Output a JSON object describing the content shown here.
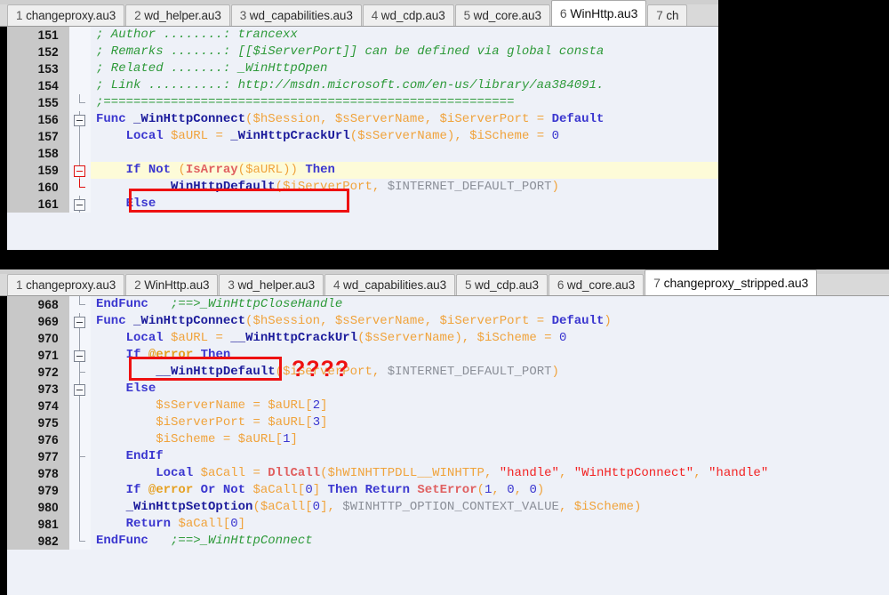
{
  "meta": {
    "app": "AutoIt Script Editor",
    "accent_annotation_color": "#ee1111",
    "highlight_line_color": "#fdfbd8",
    "code_background": "#eef1f8",
    "gutter_background": "#c8c8c8"
  },
  "top_panel": {
    "name": "original-winhttp-source",
    "active_tab_index": 5,
    "tabs": [
      {
        "num": "1",
        "label": "changeproxy.au3"
      },
      {
        "num": "2",
        "label": "wd_helper.au3"
      },
      {
        "num": "3",
        "label": "wd_capabilities.au3"
      },
      {
        "num": "4",
        "label": "wd_cdp.au3"
      },
      {
        "num": "5",
        "label": "wd_core.au3"
      },
      {
        "num": "6",
        "label": "WinHttp.au3"
      },
      {
        "num": "7",
        "label": "ch"
      }
    ],
    "first_line_number": 151,
    "highlighted_line": 159,
    "annotation": {
      "boxed_text": "If Not (IsArray($aURL))",
      "boxed_line": 159
    },
    "lines": [
      {
        "n": "151",
        "fold": "none",
        "text": "; Author ........: trancexx"
      },
      {
        "n": "152",
        "fold": "none",
        "text": "; Remarks .......: [[$iServerPort]] can be defined via global consta"
      },
      {
        "n": "153",
        "fold": "none",
        "text": "; Related .......: _WinHttpOpen"
      },
      {
        "n": "154",
        "fold": "none",
        "text": "; Link ..........: http://msdn.microsoft.com/en-us/library/aa384091."
      },
      {
        "n": "155",
        "fold": "end",
        "text": ";======================================================="
      },
      {
        "n": "156",
        "fold": "box",
        "text": "Func _WinHttpConnect($hSession, $sServerName, $iServerPort = Default"
      },
      {
        "n": "157",
        "fold": "line",
        "text": "    Local $aURL = _WinHttpCrackUrl($sServerName), $iScheme = 0"
      },
      {
        "n": "158",
        "fold": "line",
        "text": ""
      },
      {
        "n": "159",
        "fold": "box-red",
        "text": "    If Not (IsArray($aURL)) Then"
      },
      {
        "n": "160",
        "fold": "end-red",
        "text": "        __WinHttpDefault($iServerPort, $INTERNET_DEFAULT_PORT)"
      },
      {
        "n": "161",
        "fold": "box",
        "text": "    Else"
      }
    ]
  },
  "bottom_panel": {
    "name": "stripped-changeproxy-source",
    "active_tab_index": 6,
    "tabs": [
      {
        "num": "1",
        "label": "changeproxy.au3"
      },
      {
        "num": "2",
        "label": "WinHttp.au3"
      },
      {
        "num": "3",
        "label": "wd_helper.au3"
      },
      {
        "num": "4",
        "label": "wd_capabilities.au3"
      },
      {
        "num": "5",
        "label": "wd_cdp.au3"
      },
      {
        "num": "6",
        "label": "wd_core.au3"
      },
      {
        "num": "7",
        "label": "changeproxy_stripped.au3"
      }
    ],
    "first_line_number": 968,
    "annotation": {
      "boxed_text": "If @error Then",
      "boxed_line": 971,
      "marker_text": "????"
    },
    "lines": [
      {
        "n": "968",
        "fold": "end",
        "text": "EndFunc   ;==>_WinHttpCloseHandle"
      },
      {
        "n": "969",
        "fold": "box",
        "text": "Func _WinHttpConnect($hSession, $sServerName, $iServerPort = Default)"
      },
      {
        "n": "970",
        "fold": "line",
        "text": "    Local $aURL = __WinHttpCrackUrl($sServerName), $iScheme = 0"
      },
      {
        "n": "971",
        "fold": "box",
        "text": "    If @error Then"
      },
      {
        "n": "972",
        "fold": "tee",
        "text": "        __WinHttpDefault($iServerPort, $INTERNET_DEFAULT_PORT)"
      },
      {
        "n": "973",
        "fold": "box",
        "text": "    Else"
      },
      {
        "n": "974",
        "fold": "line",
        "text": "        $sServerName = $aURL[2]"
      },
      {
        "n": "975",
        "fold": "line",
        "text": "        $iServerPort = $aURL[3]"
      },
      {
        "n": "976",
        "fold": "line",
        "text": "        $iScheme = $aURL[1]"
      },
      {
        "n": "977",
        "fold": "tee",
        "text": "    EndIf"
      },
      {
        "n": "978",
        "fold": "line",
        "text": "        Local $aCall = DllCall($hWINHTTPDLL__WINHTTP, \"handle\", \"WinHttpConnect\", \"handle\""
      },
      {
        "n": "979",
        "fold": "line",
        "text": "    If @error Or Not $aCall[0] Then Return SetError(1, 0, 0)"
      },
      {
        "n": "980",
        "fold": "line",
        "text": "    _WinHttpSetOption($aCall[0], $WINHTTP_OPTION_CONTEXT_VALUE, $iScheme)"
      },
      {
        "n": "981",
        "fold": "line",
        "text": "    Return $aCall[0]"
      },
      {
        "n": "982",
        "fold": "end",
        "text": "EndFunc   ;==>_WinHttpConnect"
      }
    ]
  }
}
